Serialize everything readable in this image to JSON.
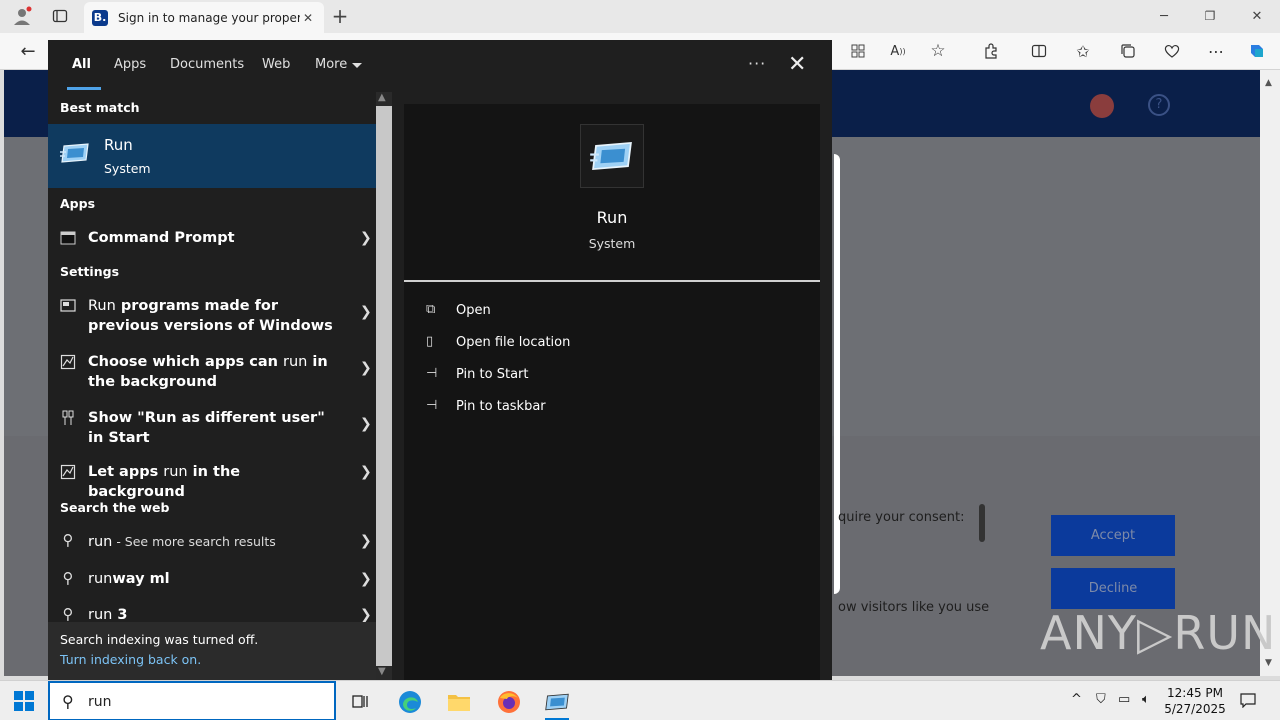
{
  "browser": {
    "tab_title": "Sign in to manage your property",
    "favicon_letter": "B."
  },
  "page": {
    "consent_text": "quire your consent:",
    "visitors_text": "ow visitors like you use",
    "accept_label": "Accept",
    "decline_label": "Decline",
    "watermark": "ANY▷RUN"
  },
  "search": {
    "tabs": [
      "All",
      "Apps",
      "Documents",
      "Web",
      "More"
    ],
    "best_match_header": "Best match",
    "best_match": {
      "title": "Run",
      "subtitle": "System"
    },
    "apps_header": "Apps",
    "apps": [
      {
        "label": "Command Prompt"
      }
    ],
    "settings_header": "Settings",
    "settings": [
      {
        "pre": "Run",
        "post": " programs made for previous versions of Windows"
      },
      {
        "pre": "Choose which apps can ",
        "mid": "run",
        "post": " in the background"
      },
      {
        "pre": "Show \"Run as different user\" in Start"
      },
      {
        "pre": "Let apps ",
        "mid": "run",
        "post": " in the background"
      }
    ],
    "web_header": "Search the web",
    "web": [
      {
        "term": "run",
        "suffix": " - See more search results"
      },
      {
        "term": "run",
        "rest": "way ml"
      },
      {
        "term": "run",
        "rest": " 3"
      }
    ],
    "footer_text": "Search indexing was turned off.",
    "footer_link": "Turn indexing back on.",
    "detail": {
      "title": "Run",
      "subtitle": "System",
      "actions": [
        "Open",
        "Open file location",
        "Pin to Start",
        "Pin to taskbar"
      ]
    }
  },
  "taskbar": {
    "search_value": "run",
    "time": "12:45 PM",
    "date": "5/27/2025"
  }
}
